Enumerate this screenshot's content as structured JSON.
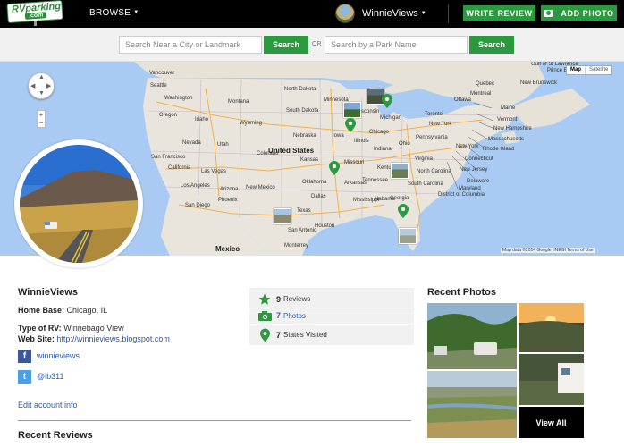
{
  "nav": {
    "logo_main": "RVparking",
    "logo_sub": ".com",
    "browse_label": "BROWSE",
    "username": "WinnieViews",
    "write_review_label": "WRITE REVIEW",
    "add_photo_label": "ADD PHOTO"
  },
  "search": {
    "city_placeholder": "Search Near a City or Landmark",
    "city_button": "Search",
    "or_label": "OR",
    "park_placeholder": "Search by a Park Name",
    "park_button": "Search"
  },
  "map": {
    "type_map": "Map",
    "type_satellite": "Satellite",
    "attribution": "Map data ©2014 Google, INEGI   Terms of Use",
    "zoom_in": "+",
    "zoom_out": "−",
    "labels": {
      "united_states": "United States",
      "mexico": "Mexico",
      "vancouver": "Vancouver",
      "seattle": "Seattle",
      "washington": "Washington",
      "oregon": "Oregon",
      "idaho": "Idaho",
      "montana": "Montana",
      "wyoming": "Wyoming",
      "nevada": "Nevada",
      "utah": "Utah",
      "colorado": "Colorado",
      "california": "California",
      "san_francisco": "San Francisco",
      "las_vegas": "Las Vegas",
      "los_angeles": "Los Angeles",
      "san_diego": "San Diego",
      "arizona": "Arizona",
      "phoenix": "Phoenix",
      "new_mexico": "New Mexico",
      "north_dakota": "North Dakota",
      "south_dakota": "South Dakota",
      "nebraska": "Nebraska",
      "kansas": "Kansas",
      "oklahoma": "Oklahoma",
      "texas": "Texas",
      "dallas": "Dallas",
      "houston": "Houston",
      "san_antonio": "San Antonio",
      "monterrey": "Monterrey",
      "minnesota": "Minnesota",
      "iowa": "Iowa",
      "missouri": "Missouri",
      "arkansas": "Arkansas",
      "illinois": "Illinois",
      "wisconsin": "Wisconsin",
      "michigan": "Michigan",
      "indiana": "Indiana",
      "ohio": "Ohio",
      "kentucky": "Kentucky",
      "tennessee": "Tennessee",
      "mississippi": "Mississippi",
      "alabama": "Alabama",
      "georgia": "Georgia",
      "chicago": "Chicago",
      "pennsylvania": "Pennsylvania",
      "new_york": "New York",
      "virginia": "Virginia",
      "north_carolina": "North Carolina",
      "south_carolina": "South Carolina",
      "ottawa": "Ottawa",
      "montreal": "Montreal",
      "toronto": "Toronto",
      "quebec": "Quebec",
      "gulf": "Gulf of St Lawrence",
      "new_brunswick": "New Brunswick",
      "pei": "Prince Edward Island",
      "maine": "Maine",
      "vermont": "Vermont",
      "new_hampshire": "New Hampshire",
      "massachusetts": "Massachusetts",
      "rhode_island": "Rhode Island",
      "connecticut": "Connecticut",
      "new_york_right": "New York",
      "new_jersey": "New Jersey",
      "delaware": "Delaware",
      "maryland": "Maryland",
      "dc": "District of Columbia"
    }
  },
  "profile": {
    "name": "WinnieViews",
    "home_base_label": "Home Base:",
    "home_base": "Chicago, IL",
    "rv_type_label": "Type of RV:",
    "rv_type": "Winnebago View",
    "website_label": "Web Site:",
    "website": "http://winnieviews.blogspot.com",
    "facebook": "winnieviews",
    "twitter": "@lb311",
    "edit_link": "Edit account info",
    "recent_reviews_title": "Recent Reviews"
  },
  "stats": {
    "reviews_count": "9",
    "reviews_label": "Reviews",
    "photos_count": "7",
    "photos_label": "Photos",
    "states_count": "7",
    "states_label": "States Visited"
  },
  "photos": {
    "title": "Recent Photos",
    "view_all": "View All"
  },
  "colors": {
    "brand_green": "#2b9a3f",
    "link_blue": "#2a5db0",
    "map_water": "#a9cbf3",
    "map_land": "#e9e5dc"
  }
}
